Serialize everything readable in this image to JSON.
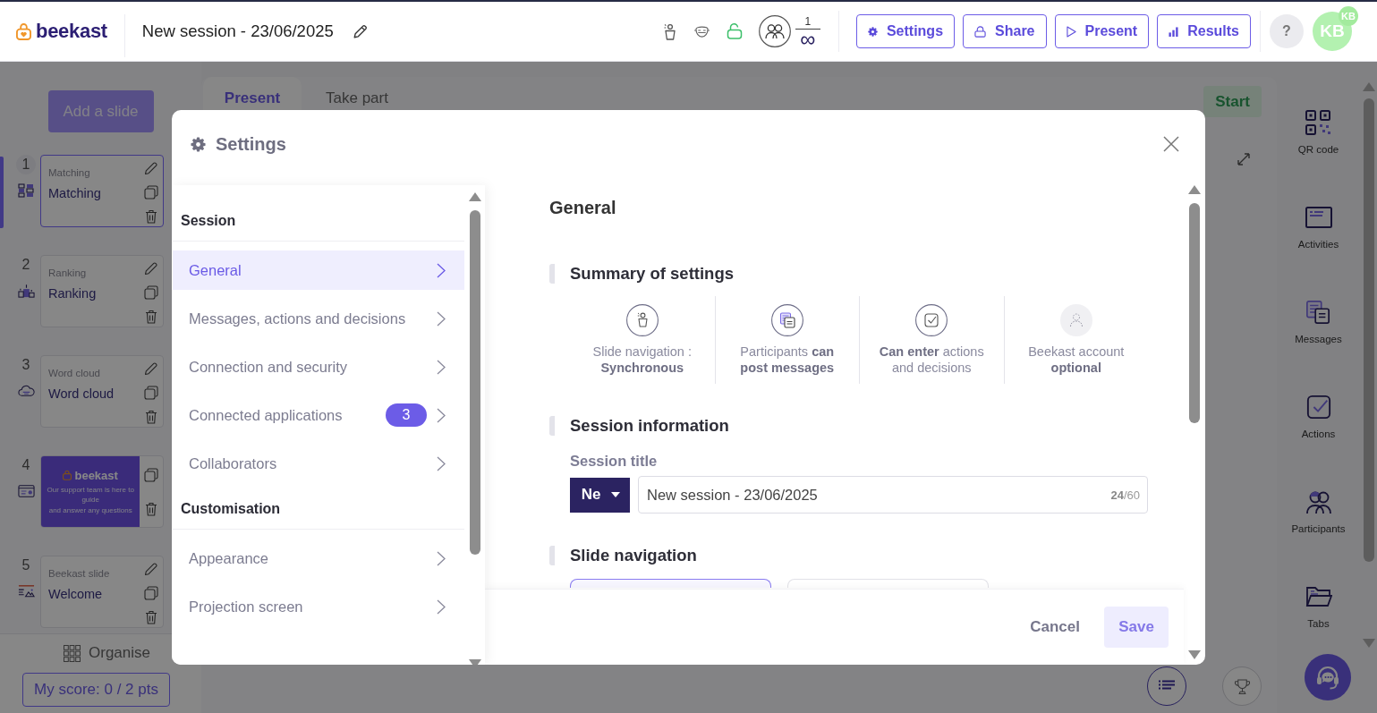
{
  "header": {
    "logo": "beekast",
    "session_title": "New session - 23/06/2025",
    "participants": {
      "count": "1",
      "limit": "∞"
    },
    "buttons": [
      "Settings",
      "Share",
      "Present",
      "Results"
    ],
    "help": "?",
    "avatar": {
      "initials": "KB",
      "badge": "KB"
    }
  },
  "sidebar": {
    "add_button": "Add a slide",
    "slides": [
      {
        "number": "1",
        "kind": "matching",
        "type": "Matching",
        "title": "Matching",
        "selected": true
      },
      {
        "number": "2",
        "kind": "ranking",
        "type": "Ranking",
        "title": "Ranking",
        "selected": false
      },
      {
        "number": "3",
        "kind": "wordcloud",
        "type": "Word cloud",
        "title": "Word cloud",
        "selected": false
      },
      {
        "number": "4",
        "kind": "image",
        "thumbnail": {
          "logo": "beekast",
          "lines": [
            "Our support team is here to guide",
            "and answer any questions"
          ]
        },
        "selected": false
      },
      {
        "number": "5",
        "kind": "slide",
        "type": "Beekast slide",
        "title": "Welcome",
        "selected": false
      }
    ],
    "organise": "Organise",
    "score": "My score: 0 / 2 pts"
  },
  "stage": {
    "tabs": [
      {
        "label": "Present",
        "selected": true
      },
      {
        "label": "Take part",
        "selected": false
      }
    ],
    "start": "Start"
  },
  "toolbar": [
    "QR code",
    "Activities",
    "Messages",
    "Actions",
    "Participants",
    "Tabs"
  ],
  "settings_dialog": {
    "title": "Settings",
    "nav": [
      {
        "heading": "Session",
        "items": [
          {
            "label": "General",
            "selected": true
          },
          {
            "label": "Messages, actions and decisions",
            "selected": false
          },
          {
            "label": "Connection and security",
            "selected": false
          },
          {
            "label": "Connected applications",
            "badge": "3",
            "selected": false
          },
          {
            "label": "Collaborators",
            "selected": false
          }
        ]
      },
      {
        "heading": "Customisation",
        "items": [
          {
            "label": "Appearance",
            "selected": false
          },
          {
            "label": "Projection screen",
            "selected": false
          }
        ]
      }
    ],
    "page_title": "General",
    "summary": {
      "heading": "Summary of settings",
      "items": [
        {
          "text": "Slide navigation : **Synchronous**",
          "active": true
        },
        {
          "text": "Participants **can post messages**",
          "active": true
        },
        {
          "text": "**Can enter** actions and decisions",
          "active": true
        },
        {
          "text": "Beekast account **optional**",
          "active": false
        }
      ]
    },
    "session_info": {
      "heading": "Session information",
      "field_label": "Session title",
      "language": "Ne",
      "value": "New session - 23/06/2025",
      "counter": "**24**/60"
    },
    "slide_navigation": {
      "heading": "Slide navigation",
      "options": [
        {
          "selected": true
        },
        {
          "selected": false
        }
      ]
    },
    "cancel": "Cancel",
    "save": {
      "label": "Save",
      "disabled": true
    }
  }
}
